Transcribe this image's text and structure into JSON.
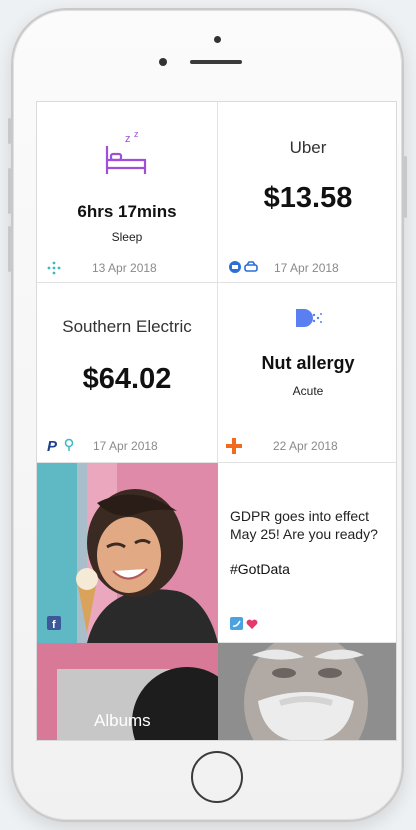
{
  "tiles": {
    "sleep": {
      "value": "6hrs 17mins",
      "label": "Sleep",
      "date": "13 Apr 2018",
      "icon": "bed-icon",
      "source_icon": "activity-tracker-icon",
      "accent": "#a04fd9"
    },
    "uber": {
      "merchant": "Uber",
      "amount": "$13.58",
      "date": "17 Apr 2018",
      "source_icons": [
        "bank-icon",
        "car-icon"
      ],
      "accent": "#2c6fd6"
    },
    "electric": {
      "merchant": "Southern Electric",
      "amount": "$64.02",
      "date": "17 Apr 2018",
      "source_icons": [
        "paypal-icon",
        "pin-icon"
      ]
    },
    "allergy": {
      "title": "Nut allergy",
      "label": "Acute",
      "date": "22 Apr 2018",
      "icon": "allergy-icon",
      "source_icon": "medical-cross-icon",
      "accent": "#f26b1d",
      "icon_color": "#5a7ff0"
    },
    "photo": {
      "source_icon": "facebook-icon",
      "colors": {
        "pink": "#e08aa9",
        "teal": "#5fb9c4"
      }
    },
    "gdpr": {
      "text": "GDPR goes into effect May 25! Are you ready?",
      "hashtag": "#GotData",
      "source_icons": [
        "twitter-icon",
        "heart-icon"
      ]
    },
    "albums": {
      "label": "Albums"
    },
    "portrait": {
      "description_icon": "portrait-photo"
    }
  }
}
